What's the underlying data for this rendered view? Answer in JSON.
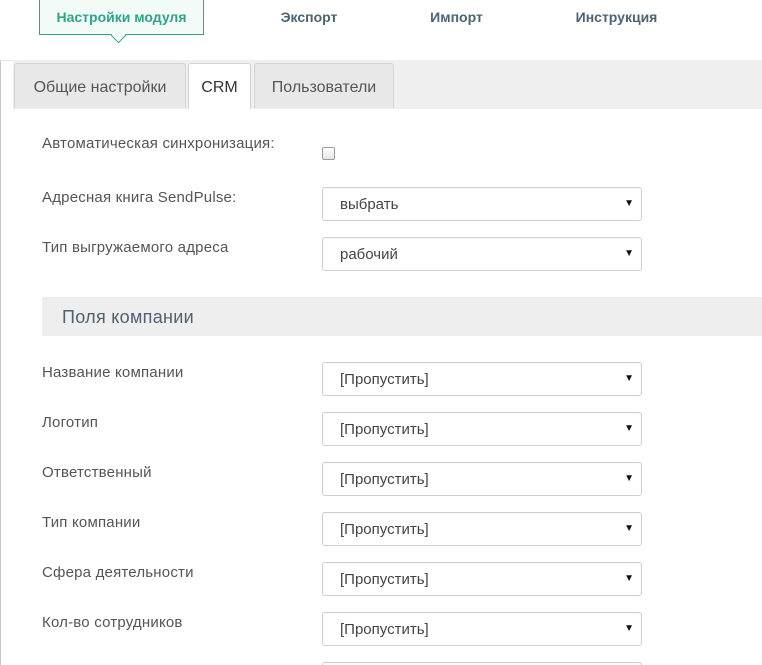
{
  "nav": {
    "items": [
      {
        "label": "Настройки модуля",
        "active": true
      },
      {
        "label": "Экспорт",
        "active": false
      },
      {
        "label": "Импорт",
        "active": false
      },
      {
        "label": "Инструкция",
        "active": false
      }
    ]
  },
  "tabs": [
    {
      "label": "Общие настройки",
      "active": false
    },
    {
      "label": "CRM",
      "active": true
    },
    {
      "label": "Пользователи",
      "active": false
    }
  ],
  "form": {
    "auto_sync": {
      "label": "Автоматическая синхронизация:",
      "checked": false
    },
    "address_book": {
      "label": "Адресная книга SendPulse:",
      "value": "выбрать"
    },
    "address_type": {
      "label": "Тип выгружаемого адреса",
      "value": "рабочий"
    }
  },
  "company_section": {
    "title": "Поля компании",
    "fields": [
      {
        "label": "Название компании",
        "value": "[Пропустить]"
      },
      {
        "label": "Логотип",
        "value": "[Пропустить]"
      },
      {
        "label": "Ответственный",
        "value": "[Пропустить]"
      },
      {
        "label": "Тип компании",
        "value": "[Пропустить]"
      },
      {
        "label": "Сфера деятельности",
        "value": "[Пропустить]"
      },
      {
        "label": "Кол-во сотрудников",
        "value": "[Пропустить]"
      }
    ]
  },
  "icons": {
    "select_arrow": "caret-down-icon"
  },
  "colors": {
    "accent": "#2ea58a",
    "nav_text": "#4d6373",
    "section_bg": "#eeeeee",
    "tab_bar_bg": "#efefef"
  }
}
